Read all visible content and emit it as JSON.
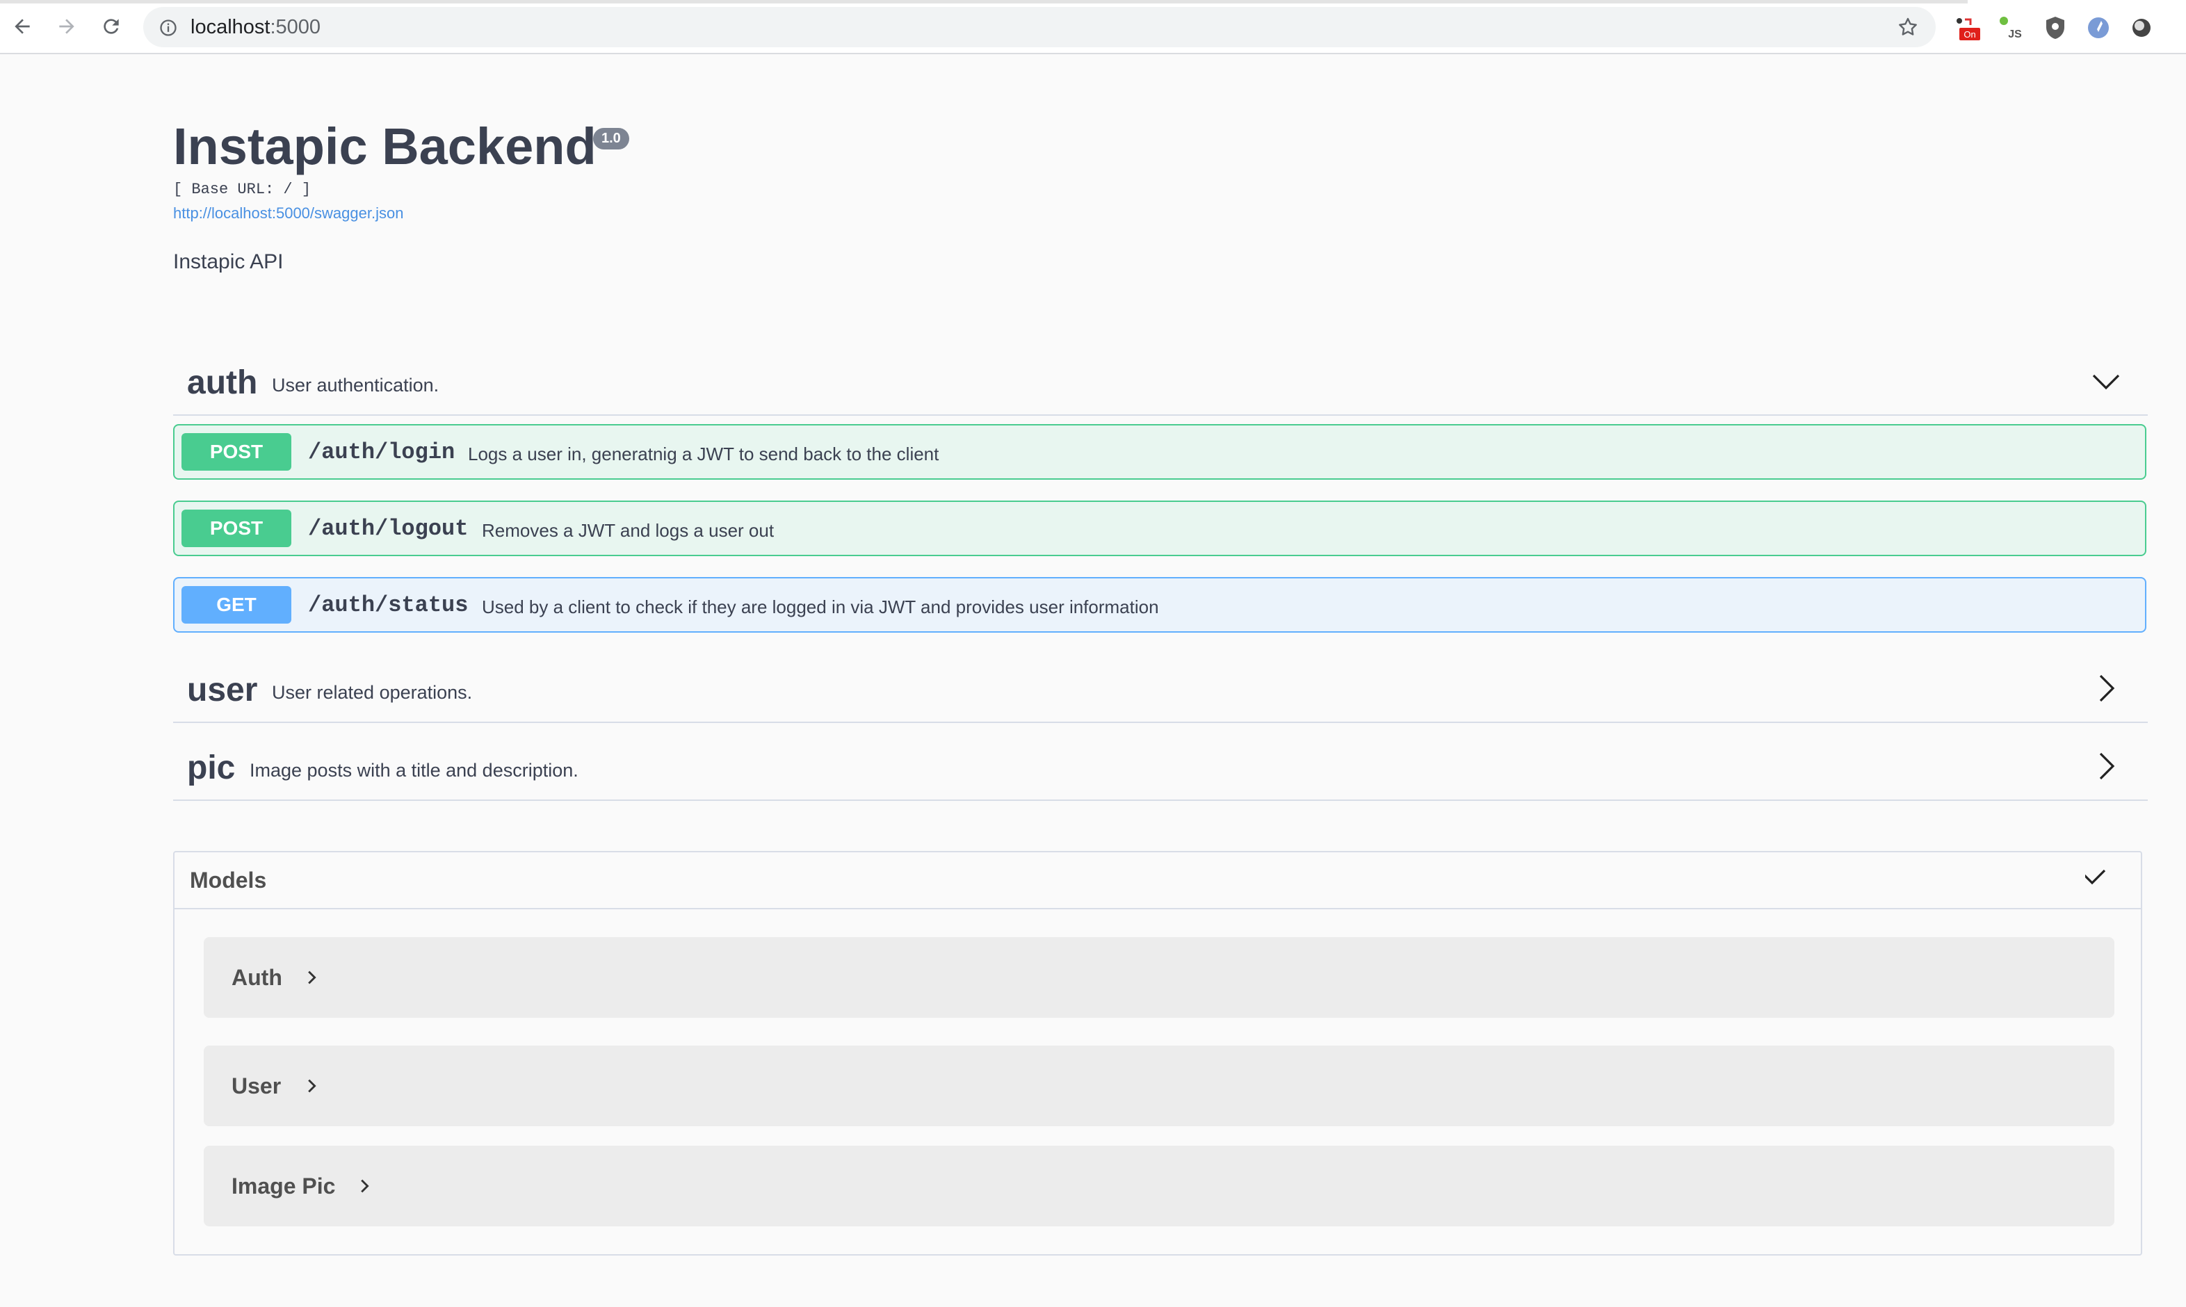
{
  "browser": {
    "url_host": "localhost",
    "url_port": ":5000",
    "extension_badge": "On",
    "extension_js_label": "JS"
  },
  "info": {
    "title": "Instapic Backend",
    "version": "1.0",
    "base_url": "[ Base URL: / ]",
    "spec_link": "http://localhost:5000/swagger.json",
    "description": "Instapic API"
  },
  "tags": [
    {
      "name": "auth",
      "description": "User authentication.",
      "expanded": true
    },
    {
      "name": "user",
      "description": "User related operations.",
      "expanded": false
    },
    {
      "name": "pic",
      "description": "Image posts with a title and description.",
      "expanded": false
    }
  ],
  "operations": [
    {
      "method": "POST",
      "path": "/auth/login",
      "summary": "Logs a user in, generatnig a JWT to send back to the client"
    },
    {
      "method": "POST",
      "path": "/auth/logout",
      "summary": "Removes a JWT and logs a user out"
    },
    {
      "method": "GET",
      "path": "/auth/status",
      "summary": "Used by a client to check if they are logged in via JWT and provides user information"
    }
  ],
  "models": {
    "title": "Models",
    "items": [
      "Auth",
      "User",
      "Image Pic"
    ]
  },
  "colors": {
    "post": "#49cc90",
    "get": "#61affe",
    "text": "#3b4151",
    "link": "#4990e2"
  }
}
